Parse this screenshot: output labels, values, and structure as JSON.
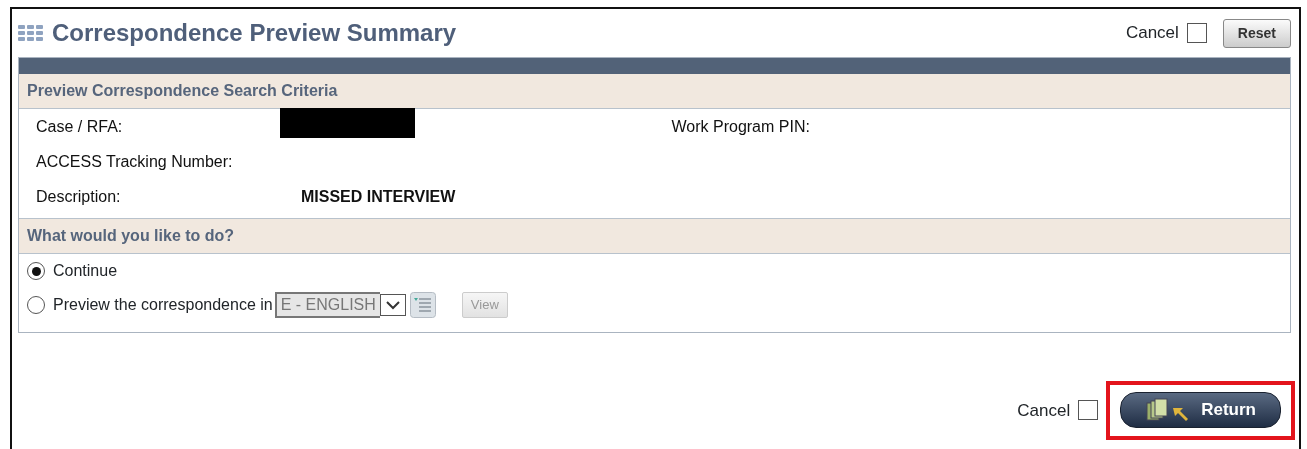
{
  "title": "Correspondence Preview Summary",
  "header_actions": {
    "cancel_label": "Cancel",
    "cancel_checked": false,
    "reset_button": "Reset"
  },
  "criteria": {
    "heading": "Preview Correspondence Search Criteria",
    "rows": [
      {
        "cells": [
          {
            "label": "Case / RFA:",
            "redacted": true
          },
          {
            "label": "Work Program PIN:"
          }
        ]
      },
      {
        "cells": [
          {
            "label": "ACCESS Tracking Number:"
          }
        ]
      },
      {
        "cells": [
          {
            "label": "Description:",
            "value": "MISSED INTERVIEW"
          }
        ]
      }
    ]
  },
  "options": {
    "heading": "What would you like to do?",
    "items": [
      {
        "kind": "plain",
        "label": "Continue",
        "selected": true
      },
      {
        "kind": "language",
        "label": "Preview the correspondence in",
        "selected": false,
        "language": "E - ENGLISH",
        "view_button": "View",
        "disabled": true
      }
    ]
  },
  "footer": {
    "cancel_label": "Cancel",
    "cancel_checked": false,
    "return_button": "Return",
    "highlighted": true
  }
}
